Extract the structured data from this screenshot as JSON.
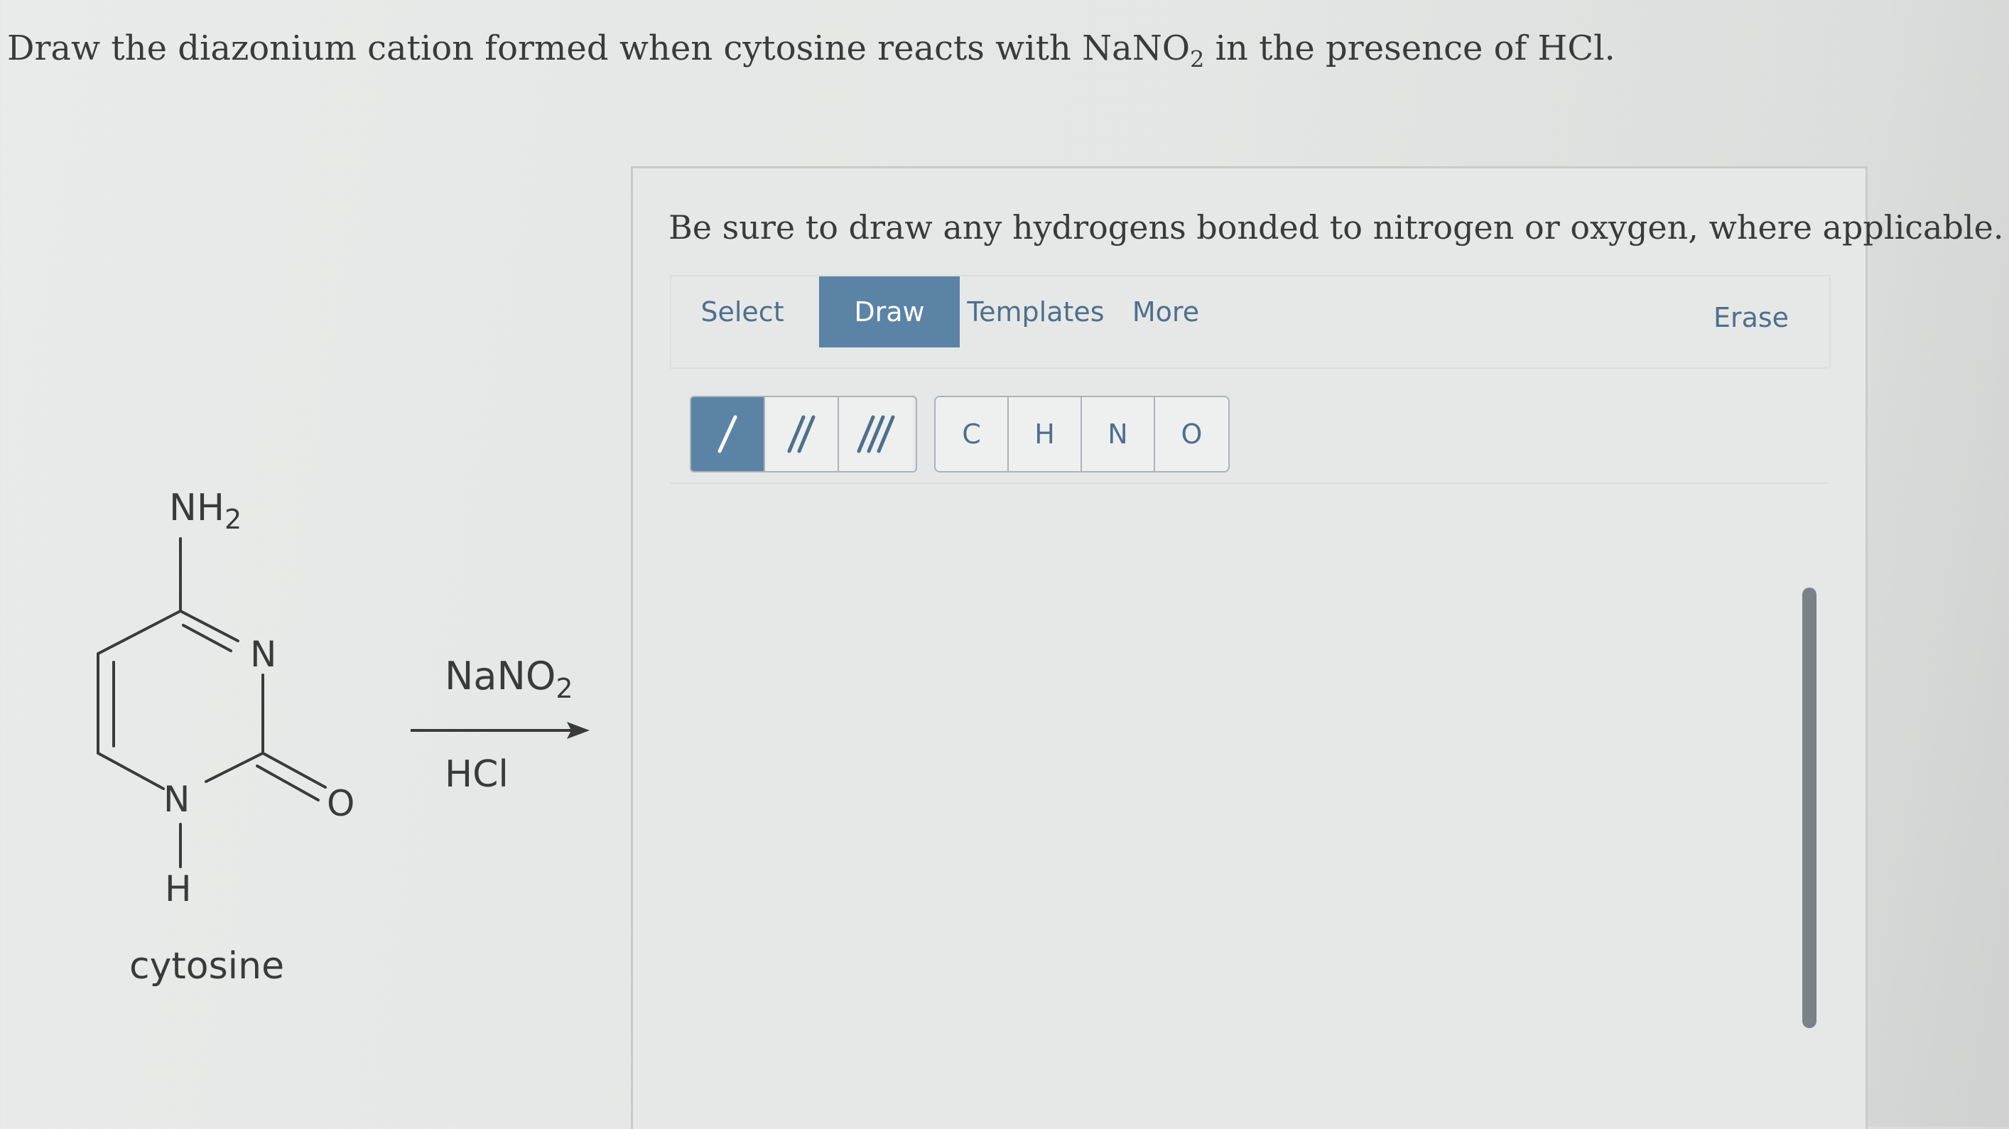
{
  "question": {
    "text_before": "Draw the diazonium cation formed when cytosine reacts with NaNO",
    "subscript": "2",
    "text_after": " in the presence of HCl."
  },
  "reaction": {
    "molecule_name": "cytosine",
    "atom_labels": {
      "amine": "NH",
      "amine_sub": "2",
      "ring_n_top": "N",
      "ring_n_bottom": "N",
      "hydrogen": "H",
      "oxygen": "O"
    },
    "reagent_top": "NaNO",
    "reagent_top_sub": "2",
    "reagent_bottom": "HCl"
  },
  "panel": {
    "instruction": "Be sure to draw any hydrogens bonded to nitrogen or oxygen, where applicable.",
    "tabs": {
      "select": "Select",
      "draw": "Draw",
      "templates": "Templates",
      "more": "More",
      "erase": "Erase"
    },
    "active_tab": "Draw",
    "bond_tools": [
      "single-bond",
      "double-bond",
      "triple-bond"
    ],
    "active_bond": "single-bond",
    "atoms": [
      "C",
      "H",
      "N",
      "O"
    ]
  },
  "colors": {
    "accent": "#5b83a6",
    "link": "#4f6f8d",
    "text": "#3a3a3a"
  }
}
